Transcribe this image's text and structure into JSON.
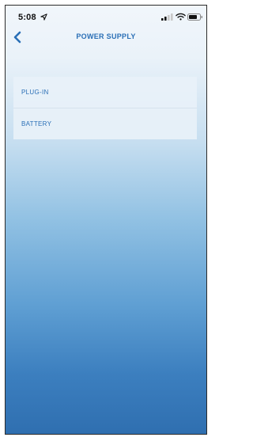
{
  "status_bar": {
    "time": "5:08",
    "location_icon": "location-arrow-icon",
    "signal_icon": "cellular-signal-icon",
    "wifi_icon": "wifi-icon",
    "battery_icon": "battery-icon"
  },
  "nav": {
    "title": "POWER SUPPLY",
    "back_icon": "chevron-left-icon"
  },
  "options": [
    {
      "label": "PLUG-IN"
    },
    {
      "label": "BATTERY"
    }
  ],
  "colors": {
    "accent": "#2a6fb6",
    "gradient_top": "#f1f6fb",
    "gradient_bottom": "#2f6fb0"
  }
}
